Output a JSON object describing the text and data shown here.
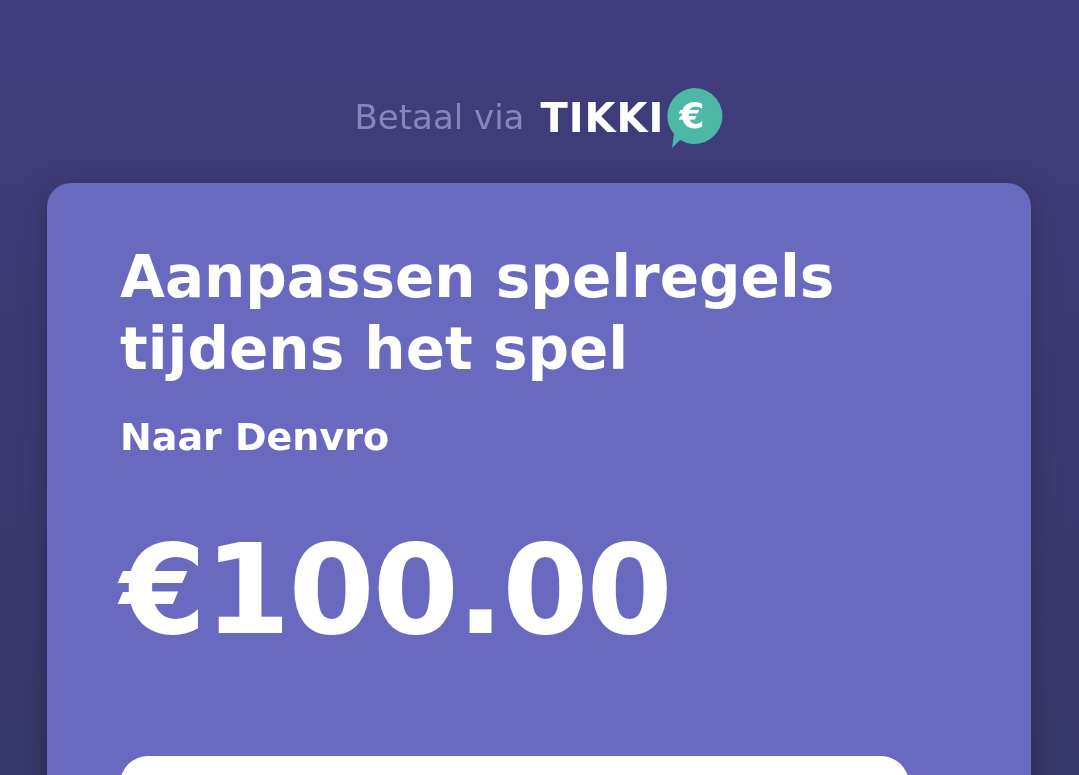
{
  "header": {
    "prefix": "Betaal via",
    "brand": "TIKKI",
    "brand_mark": "€"
  },
  "request": {
    "title": "Aanpassen spelregels tijdens het spel",
    "recipient": "Naar Denvro",
    "amount": "€100.00"
  }
}
